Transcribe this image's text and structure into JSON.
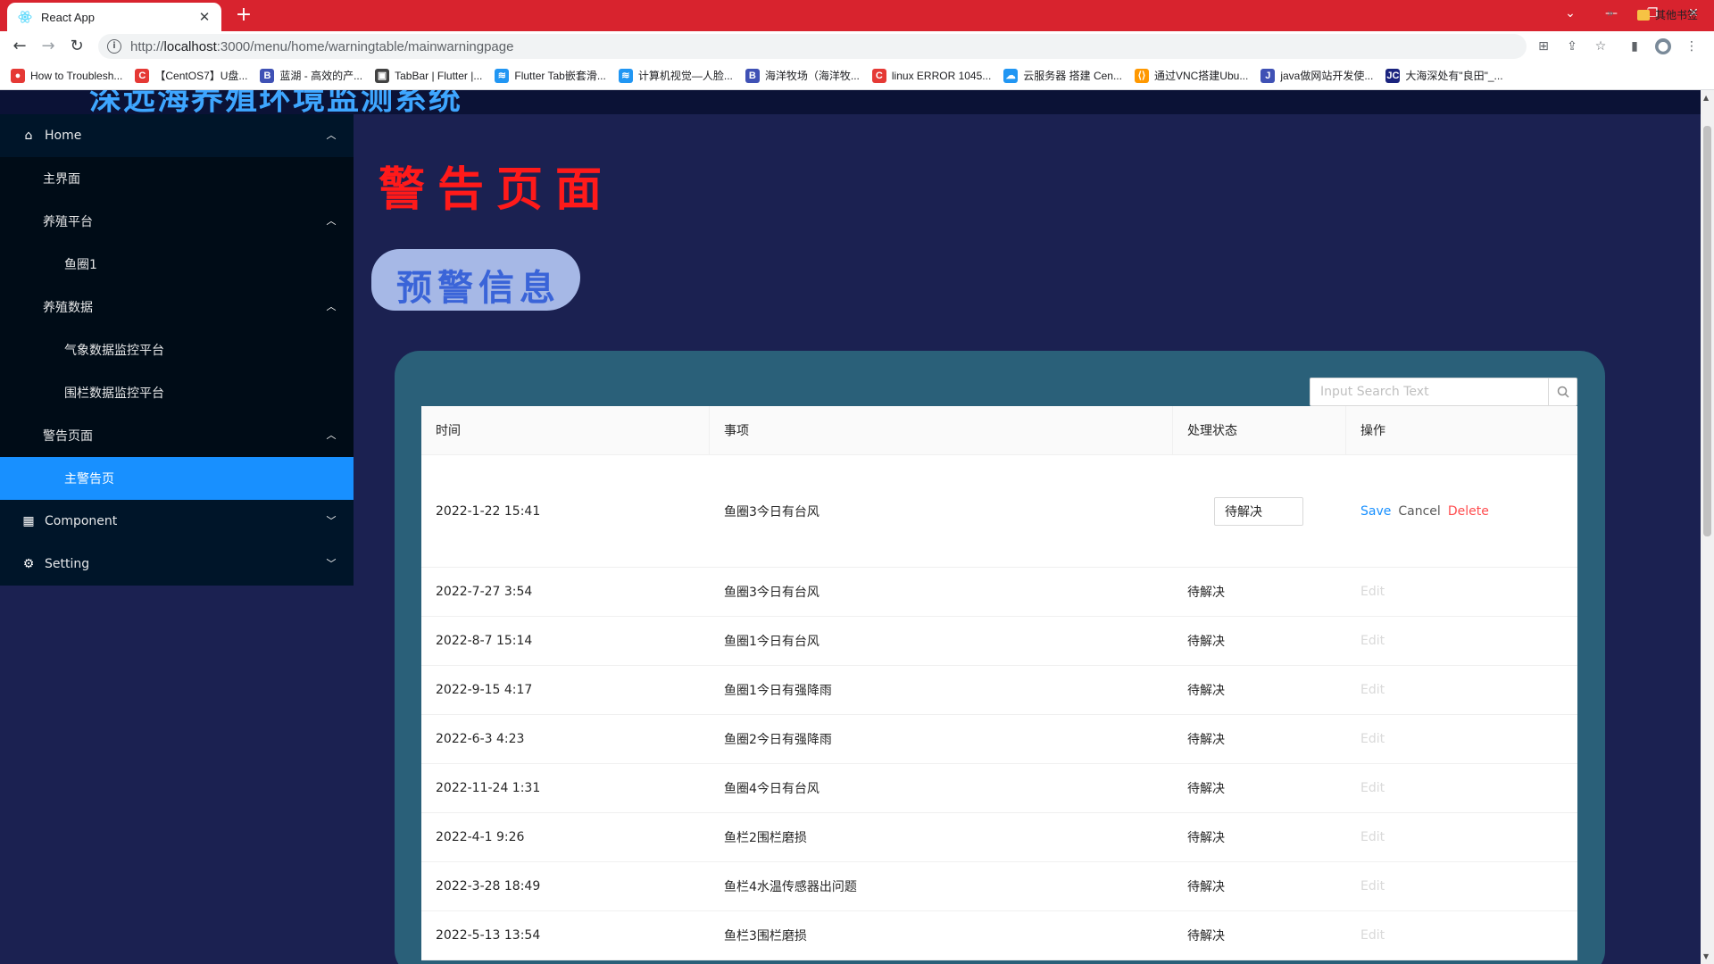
{
  "browser": {
    "tab_title": "React App",
    "url_host": "localhost",
    "url_prefix": "http://",
    "url_path": ":3000/menu/home/warningtable/mainwarningpage",
    "bookmarks": [
      {
        "label": "How to Troublesh...",
        "icon_color": "#e53935",
        "glyph": "●"
      },
      {
        "label": "【CentOS7】U盘...",
        "icon_color": "#e53935",
        "glyph": "C"
      },
      {
        "label": "蓝湖 - 高效的产...",
        "icon_color": "#3f51b5",
        "glyph": "B"
      },
      {
        "label": "TabBar | Flutter |...",
        "icon_color": "#424242",
        "glyph": "▣"
      },
      {
        "label": "Flutter Tab嵌套滑...",
        "icon_color": "#2196f3",
        "glyph": "≋"
      },
      {
        "label": "计算机视觉—人脸...",
        "icon_color": "#2196f3",
        "glyph": "≋"
      },
      {
        "label": "海洋牧场（海洋牧...",
        "icon_color": "#3f51b5",
        "glyph": "B"
      },
      {
        "label": "linux ERROR 1045...",
        "icon_color": "#e53935",
        "glyph": "C"
      },
      {
        "label": "云服务器 搭建 Cen...",
        "icon_color": "#2196f3",
        "glyph": "☁"
      },
      {
        "label": "通过VNC搭建Ubu...",
        "icon_color": "#ff9800",
        "glyph": "⟨⟩"
      },
      {
        "label": "java做网站开发使...",
        "icon_color": "#3f51b5",
        "glyph": "J"
      },
      {
        "label": "大海深处有\"良田\"_...",
        "icon_color": "#1a237e",
        "glyph": "JC"
      }
    ],
    "other_bookmarks": "其他书签",
    "more": "»"
  },
  "app": {
    "brand": "深远海养殖环境监测系统",
    "sidebar": {
      "items": [
        {
          "label": "Home",
          "level": 1,
          "icon": "home-icon",
          "expanded": true
        },
        {
          "label": "主界面",
          "level": 2
        },
        {
          "label": "养殖平台",
          "level": 2,
          "expanded": true
        },
        {
          "label": "鱼圈1",
          "level": 3
        },
        {
          "label": "养殖数据",
          "level": 2,
          "expanded": true
        },
        {
          "label": "气象数据监控平台",
          "level": 3
        },
        {
          "label": "围栏数据监控平台",
          "level": 3
        },
        {
          "label": "警告页面",
          "level": 2,
          "expanded": true
        },
        {
          "label": "主警告页",
          "level": 3,
          "selected": true
        },
        {
          "label": "Component",
          "level": 1,
          "icon": "appstore-icon",
          "expanded": false
        },
        {
          "label": "Setting",
          "level": 1,
          "icon": "setting-icon",
          "expanded": false
        }
      ]
    },
    "page_title": "警告页面",
    "section_title": "预警信息",
    "search": {
      "placeholder": "Input Search Text"
    },
    "table": {
      "columns": [
        "时间",
        "事项",
        "处理状态",
        "操作"
      ],
      "editing_row": {
        "time": "2022-1-22 15:41",
        "event": "鱼圈3今日有台风",
        "status": "待解决",
        "actions": {
          "save": "Save",
          "cancel": "Cancel",
          "delete": "Delete"
        }
      },
      "rows": [
        {
          "time": "2022-7-27 3:54",
          "event": "鱼圈3今日有台风",
          "status": "待解决",
          "action": "Edit"
        },
        {
          "time": "2022-8-7 15:14",
          "event": "鱼圈1今日有台风",
          "status": "待解决",
          "action": "Edit"
        },
        {
          "time": "2022-9-15 4:17",
          "event": "鱼圈1今日有强降雨",
          "status": "待解决",
          "action": "Edit"
        },
        {
          "time": "2022-6-3 4:23",
          "event": "鱼圈2今日有强降雨",
          "status": "待解决",
          "action": "Edit"
        },
        {
          "time": "2022-11-24 1:31",
          "event": "鱼圈4今日有台风",
          "status": "待解决",
          "action": "Edit"
        },
        {
          "time": "2022-4-1 9:26",
          "event": "鱼栏2围栏磨损",
          "status": "待解决",
          "action": "Edit"
        },
        {
          "time": "2022-3-28 18:49",
          "event": "鱼栏4水温传感器出问题",
          "status": "待解决",
          "action": "Edit"
        },
        {
          "time": "2022-5-13 13:54",
          "event": "鱼栏3围栏磨损",
          "status": "待解决",
          "action": "Edit"
        }
      ]
    }
  }
}
